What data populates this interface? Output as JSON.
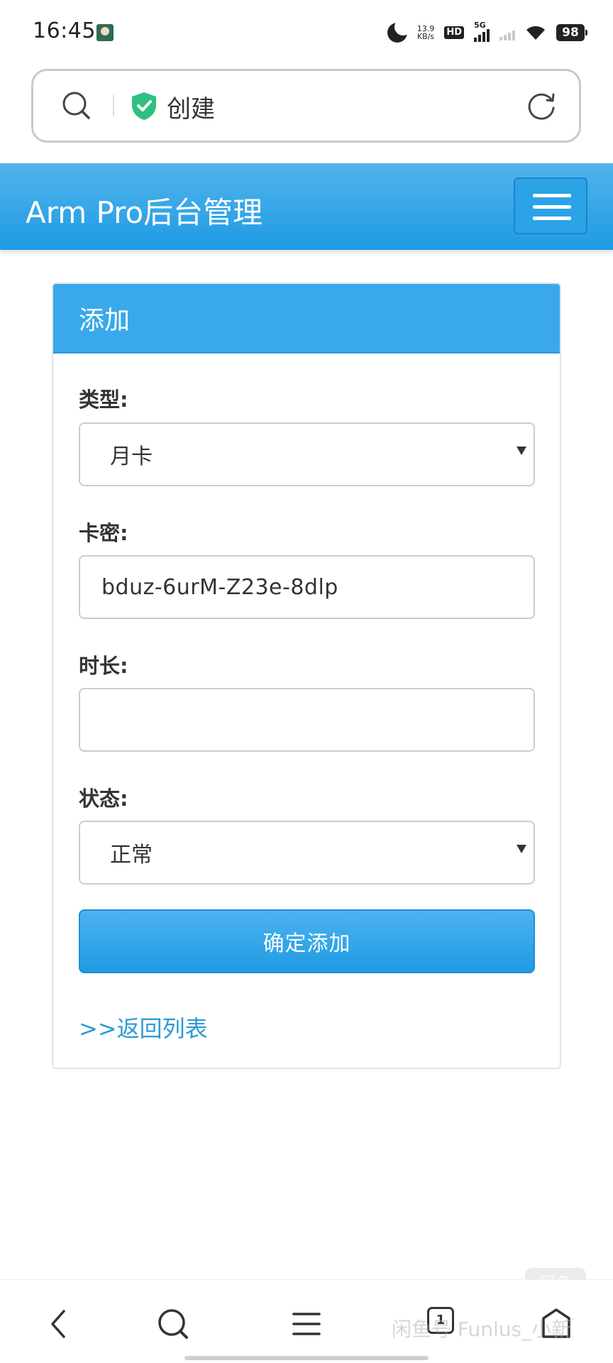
{
  "status_bar": {
    "time": "16:45",
    "net_speed_value": "13.9",
    "net_speed_unit": "KB/s",
    "hd_label": "HD",
    "network_label": "5G",
    "battery": "98"
  },
  "browser": {
    "address_title": "创建"
  },
  "header": {
    "brand": "Arm Pro后台管理"
  },
  "panel": {
    "title": "添加",
    "type_label": "类型:",
    "type_value": "月卡",
    "key_label": "卡密:",
    "key_value": "bduz-6urM-Z23e-8dlp",
    "duration_label": "时长:",
    "duration_value": "",
    "status_label": "状态:",
    "status_value": "正常",
    "submit_label": "确定添加",
    "back_link": ">>返回列表"
  },
  "bottom_nav": {
    "tab_count": "1"
  },
  "watermark": {
    "text": "闲鱼号 Funlus_小新",
    "badge": "闲鱼"
  },
  "colors": {
    "header_blue": "#1e9be3",
    "panel_heading": "#39a9ec",
    "link": "#2b9bd3",
    "shield_green": "#2fbf82"
  }
}
